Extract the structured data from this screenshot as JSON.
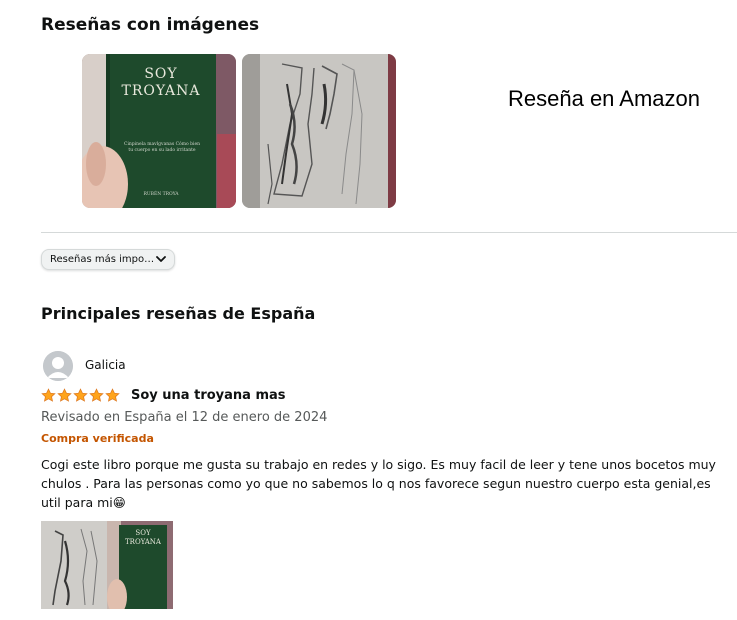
{
  "images_section": {
    "title": "Reseñas con imágenes",
    "images": [
      {
        "book_title_line1": "SOY",
        "book_title_line2": "TROYANA",
        "book_subtitle": "Cinpinela mavlgvanas Cómo bien tu cuerpo en su lado irritante",
        "book_author": "RUBÉN TROYA"
      },
      {
        "description_hidden": true
      }
    ],
    "caption": "Reseña en Amazon"
  },
  "sort": {
    "selected": "Reseñas más impo…",
    "icon": "chevron-down-icon"
  },
  "reviews_section": {
    "title": "Principales reseñas de España"
  },
  "review": {
    "author": "Galicia",
    "rating": 5,
    "rating_max": 5,
    "title": "Soy una troyana mas",
    "date_text": "Revisado en España el 12 de enero de 2024",
    "verified": "Compra verificada",
    "body": "Cogi este libro porque me gusta su trabajo en redes y lo sigo. Es muy facil de leer y tene unos bocetos muy chulos . Para las personas como yo que no sabemos lo q nos favorece segun nuestro cuerpo esta genial,es util para mi😁"
  },
  "colors": {
    "star": "#ffa41c",
    "verified": "#c45500",
    "book_cover": "#1e4a2c",
    "divider": "#d5d9d9"
  }
}
